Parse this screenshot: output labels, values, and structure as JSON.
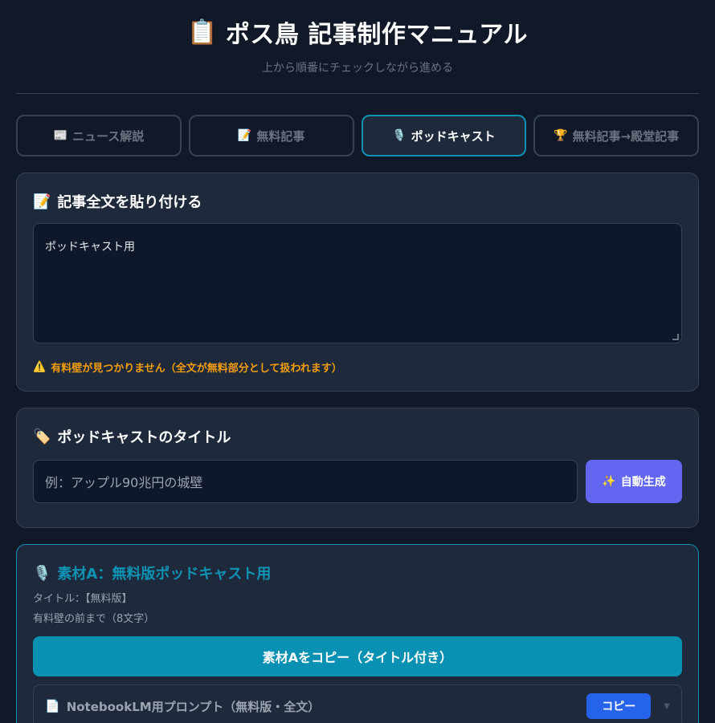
{
  "header": {
    "icon": "📋",
    "title": "ポス鳥 記事制作マニュアル",
    "subtitle": "上から順番にチェックしながら進める"
  },
  "tabs": [
    {
      "icon": "📰",
      "label": "ニュース解説",
      "active": false
    },
    {
      "icon": "📝",
      "label": "無料記事",
      "active": false
    },
    {
      "icon": "🎙️",
      "label": "ポッドキャスト",
      "active": true
    },
    {
      "icon": "🏆",
      "label": "無料記事→殿堂記事",
      "active": false
    }
  ],
  "article": {
    "icon": "📝",
    "heading": "記事全文を貼り付ける",
    "value": "ポッドキャスト用",
    "warning_icon": "⚠️",
    "warning": "有料壁が見つかりません（全文が無料部分として扱われます）"
  },
  "podcast_title": {
    "icon": "🏷️",
    "heading": "ポッドキャストのタイトル",
    "placeholder": "例：アップル90兆円の城壁",
    "generate_icon": "✨",
    "generate_label": "自動生成"
  },
  "material_a": {
    "icon": "🎙️",
    "heading": "素材A：無料版ポッドキャスト用",
    "title_line": "タイトル：【無料版】",
    "length_line": "有料壁の前まで（8文字）",
    "copy_label": "素材Aをコピー（タイトル付き）",
    "prompt_icon": "📄",
    "prompt_label": "NotebookLM用プロンプト（無料版・全文）",
    "prompt_copy_label": "コピー",
    "chevron": "▼"
  },
  "colors": {
    "background": "#111827",
    "card": "#1e293b",
    "accent_teal": "#0e93b4",
    "warning": "#f59e0b",
    "generate": "#6366f1",
    "copy_blue": "#2563eb"
  }
}
